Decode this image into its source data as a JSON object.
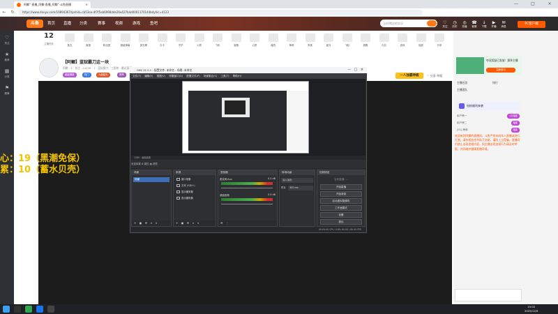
{
  "browser": {
    "tab_title": "阿鲫”·直播_阿鲫·直播_阿鲫”·斗鱼直播",
    "close_glyph": "×",
    "url": "https://www.douyu.com/10894367dyshid=cb53ea-df7f5ab6998dde26e427b4d0001170144bdyhic=4123",
    "win_min": "—",
    "win_max": "□",
    "win_close": "×"
  },
  "site": {
    "logo": "斗鱼",
    "nav": [
      "首页",
      "直播",
      "分类",
      "赛事",
      "视频",
      "游戏",
      "鱼吧"
    ],
    "search_placeholder": "出伴猪达的实况",
    "header_icons": [
      {
        "label": "关注",
        "icon": "heart-icon",
        "glyph": "♡"
      },
      {
        "label": "历史",
        "icon": "clock-icon",
        "glyph": "◷"
      },
      {
        "label": "充值",
        "icon": "coin-icon",
        "glyph": "◎"
      },
      {
        "label": "客服",
        "icon": "headset-icon",
        "glyph": "☎"
      },
      {
        "label": "下载",
        "icon": "download-icon",
        "glyph": "↓"
      },
      {
        "label": "开播",
        "icon": "camera-icon",
        "glyph": "▶"
      },
      {
        "label": "消息",
        "icon": "bell-icon",
        "glyph": "✉"
      }
    ],
    "top_button": "PC客户端"
  },
  "left_rail": [
    {
      "label": "关注",
      "glyph": "♡"
    },
    {
      "label": "推荐",
      "glyph": "★"
    },
    {
      "label": "分类",
      "glyph": "▦"
    },
    {
      "label": "赛事",
      "glyph": "⚑"
    }
  ],
  "gift_bar": {
    "level_number": "12",
    "level_label": "主播任务",
    "items": [
      "鱼丸",
      "鱼翅",
      "粉丝团",
      "超级弹幕",
      "荧光棒",
      "办卡",
      "守护",
      "火箭",
      "飞机",
      "宝箱",
      "心愿",
      "道具",
      "神壕",
      "贵族",
      "星光",
      "飞船",
      "超跑",
      "礼包",
      "游戏",
      "抽奖",
      "分享"
    ]
  },
  "room": {
    "title": "【阿鲫】蓝狱霸刀这一块",
    "sub": "阿鲫 · 4 · 关注 · 14236 · 1 · 蓝狱霸刀 · 三国杀 · 最近直播",
    "tags": [
      "超级弹幕",
      "热门",
      "九级星光",
      "推荐"
    ],
    "orange_btn": "一人独霸神殿",
    "actions": "♡ 分享  举报"
  },
  "danmaku": [
    "心：19（黑潮免保）",
    "累：10（蓄水贝壳）"
  ],
  "obs": {
    "title": "OBS 31.0.1 - 配置文件: 未命名 - 场景: 未命名",
    "menu": "文件(F) 编辑(E) 视图(V) 停靠窗口(D) 配置文件(P) 场景集合(S) 工具(T) 帮助(H)",
    "strip": "1280 · 画面设置",
    "bar2": "未选择源  ⚙ 属性  ▦ 滤镜",
    "docks": {
      "scenes": {
        "title": "场景",
        "scene": "场景"
      },
      "sources": {
        "title": "来源",
        "items": [
          "窗口采集",
          "文本 (GDI+)",
          "显示器采集",
          "显示器采集"
        ]
      },
      "mixer": {
        "title": "混音器",
        "tracks": [
          "麦克风/Aux",
          "桌面音频"
        ],
        "db": [
          "0.0 dB",
          "0.0 dB"
        ]
      },
      "transitions": {
        "title": "转场动画",
        "type": "淡入淡出",
        "duration_label": "时长",
        "duration": "300 ms"
      },
      "controls": {
        "title": "控制按钮",
        "buttons": [
          "开始直播",
          "开始录制",
          "启动虚拟摄像机",
          "工作室模式",
          "设置",
          "退出"
        ],
        "placeholder": "当前直播: ..."
      }
    },
    "status": "00:00:00  CPU: 0.8%  60.00 / 60.00 FPS"
  },
  "right_panel": {
    "promo_title": "夺冠奖励已发放！赛季主播",
    "promo_btn": "立即参与",
    "tabs": [
      "主播任务",
      "排行",
      "主播团队"
    ],
    "badge": "钻粉福利来袭",
    "list": [
      {
        "name": "用户榜一",
        "pill": "4万抽奖"
      },
      {
        "name": "用户榜二",
        "pill": "抽奖"
      },
      {
        "name": "[01]  榜首",
        "pill": "抽奖"
      }
    ],
    "chat_notice": "欢迎来到阿鲫的直播间，斗鱼严禁未成年人直播或进行打赏，请勿相信任何私下交易，谨防上当受骗。直播间内禁止出现违规内容，如主播出现违规行为请及时举报，共同维护健康直播环境。"
  },
  "taskbar": {
    "time": "15:02",
    "date": "2025/12/9"
  }
}
